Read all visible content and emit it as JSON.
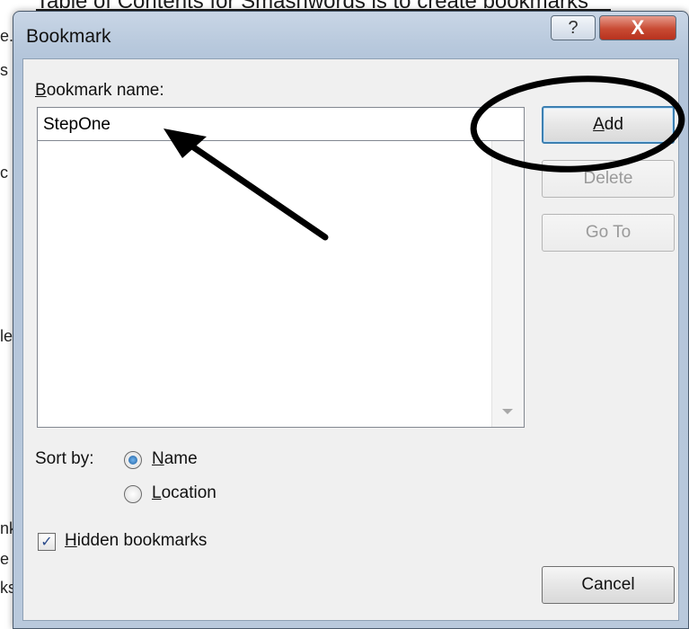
{
  "background": {
    "title_fragment": "Table of Contents for Smashwords is to create bookmarks",
    "left_fragments": [
      "e.",
      "s i",
      "c",
      "le",
      "nk",
      "e",
      "ks"
    ]
  },
  "window": {
    "title": "Bookmark",
    "help_glyph": "?",
    "close_glyph": "X"
  },
  "form": {
    "bookmark_name_label_accel": "B",
    "bookmark_name_label_rest": "ookmark name:",
    "bookmark_name_value": "StepOne",
    "bookmark_list": [],
    "sort_by_label": "Sort by:",
    "sort_options": [
      {
        "accel": "N",
        "rest": "ame",
        "checked": true
      },
      {
        "accel": "L",
        "rest": "ocation",
        "checked": false
      }
    ],
    "hidden_bookmarks": {
      "accel": "H",
      "rest": "idden bookmarks",
      "checked": true,
      "check_glyph": "✓"
    }
  },
  "buttons": {
    "add": {
      "accel": "A",
      "rest": "dd"
    },
    "delete": "Delete",
    "goto": "Go To",
    "cancel": "Cancel"
  },
  "colors": {
    "title_gradient_top": "#c9d6e6",
    "close_red": "#c84a33",
    "primary_border": "#3c7fb1",
    "annotation": "#000000"
  }
}
